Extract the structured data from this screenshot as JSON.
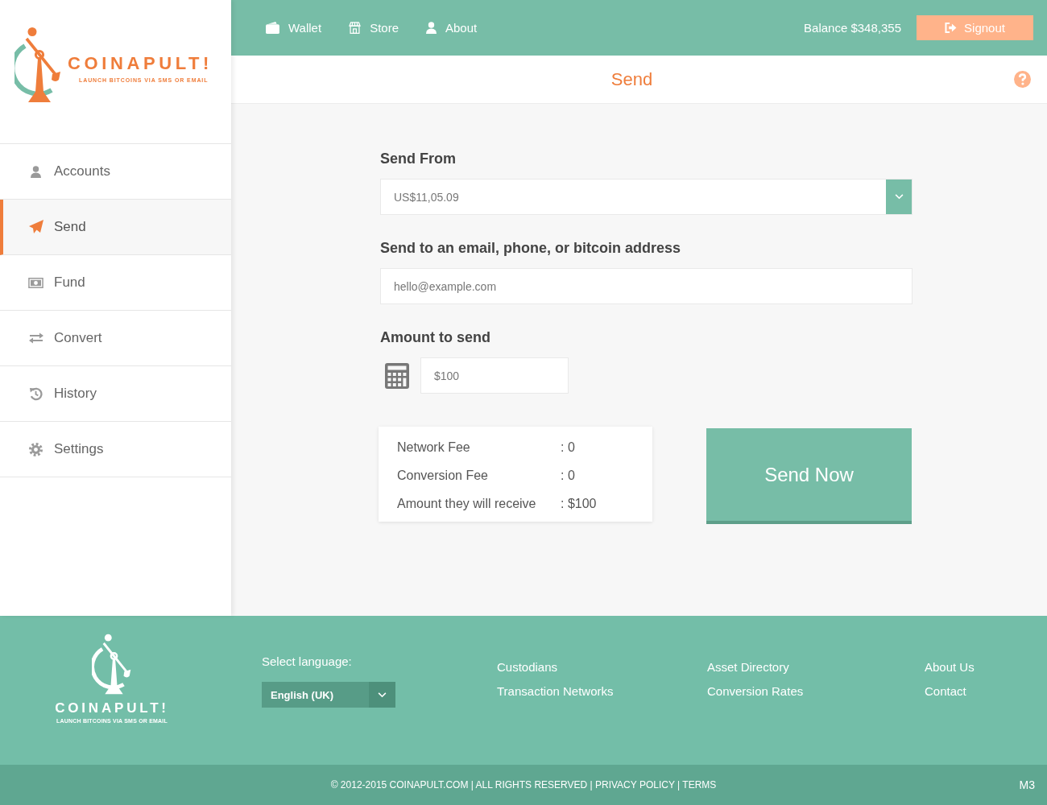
{
  "logo": {
    "name": "COINAPULT!",
    "tagline": "LAUNCH BITCOINS VIA SMS OR EMAIL"
  },
  "top_nav": {
    "items": [
      {
        "label": "Wallet"
      },
      {
        "label": "Store"
      },
      {
        "label": "About"
      }
    ],
    "balance": "Balance $348,355",
    "signout": "Signout"
  },
  "page_title": "Send",
  "sidebar": {
    "items": [
      {
        "label": "Accounts",
        "selected": false
      },
      {
        "label": "Send",
        "selected": true
      },
      {
        "label": "Fund",
        "selected": false
      },
      {
        "label": "Convert",
        "selected": false
      },
      {
        "label": "History",
        "selected": false
      },
      {
        "label": "Settings",
        "selected": false
      }
    ]
  },
  "form": {
    "send_from": {
      "label": "Send From",
      "value": "US$11,05.09"
    },
    "recipient": {
      "label": "Send to an email, phone, or bitcoin address",
      "placeholder": "hello@example.com"
    },
    "amount": {
      "label": "Amount to send",
      "value": "$100"
    }
  },
  "fees": [
    {
      "label": "Network Fee",
      "value": ": 0"
    },
    {
      "label": "Conversion Fee",
      "value": ": 0"
    },
    {
      "label": "Amount they will receive",
      "value": ": $100"
    }
  ],
  "send_button": "Send Now",
  "footer": {
    "logo": {
      "name": "COINAPULT!",
      "tagline": "LAUNCH BITCOINS VIA SMS OR EMAIL"
    },
    "language": {
      "label": "Select language:",
      "value": "English (UK)"
    },
    "link_columns": [
      {
        "links": [
          "Custodians",
          "Transaction Networks"
        ]
      },
      {
        "links": [
          "Asset Directory",
          "Conversion Rates"
        ]
      },
      {
        "links": [
          "About Us",
          "Contact"
        ]
      }
    ],
    "copyright": "© 2012-2015 COINAPULT.COM | ALL RIGHTS RESERVED",
    "separator": "|",
    "legal_links": [
      "PRIVACY POLICY",
      "TERMS"
    ],
    "version": "M3"
  }
}
